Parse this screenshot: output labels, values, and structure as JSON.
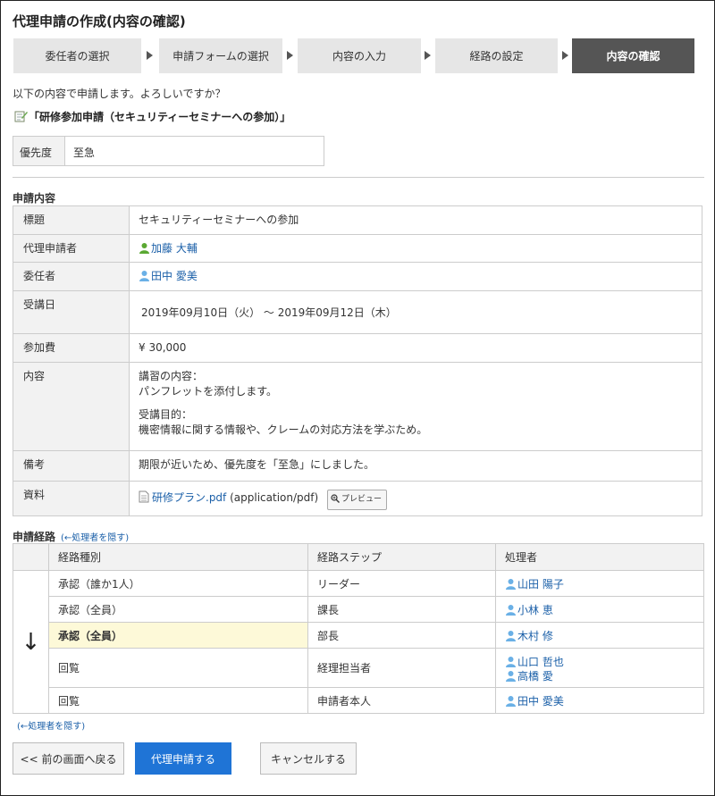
{
  "page": {
    "title": "代理申請の作成(内容の確認)",
    "confirm_message": "以下の内容で申請します。よろしいですか？",
    "form_name": "「研修参加申請（セキュリティーセミナーへの参加）」"
  },
  "steps": [
    {
      "label": "委任者の選択",
      "active": false
    },
    {
      "label": "申請フォームの選択",
      "active": false
    },
    {
      "label": "内容の入力",
      "active": false
    },
    {
      "label": "経路の設定",
      "active": false
    },
    {
      "label": "内容の確認",
      "active": true
    }
  ],
  "priority": {
    "label": "優先度",
    "value": "至急"
  },
  "detail": {
    "section_title": "申請内容",
    "rows": {
      "subject": {
        "label": "標題",
        "value": "セキュリティーセミナーへの参加"
      },
      "proxy": {
        "label": "代理申請者",
        "value": "加藤 大輔"
      },
      "delegator": {
        "label": "委任者",
        "value": "田中 愛美"
      },
      "date": {
        "label": "受講日",
        "value": "2019年09月10日（火） 〜 2019年09月12日（木）"
      },
      "fee": {
        "label": "参加費",
        "value": "¥ 30,000"
      },
      "content": {
        "label": "内容",
        "lines": [
          "講習の内容：",
          "パンフレットを添付します。",
          "",
          "受講目的：",
          "機密情報に関する情報や、クレームの対応方法を学ぶため。"
        ]
      },
      "note": {
        "label": "備考",
        "value": "期限が近いため、優先度を「至急」にしました。"
      },
      "file": {
        "label": "資料",
        "filename": "研修プラン.pdf",
        "mime": "(application/pdf)",
        "preview_label": "プレビュー"
      }
    }
  },
  "route": {
    "section_title": "申請経路",
    "hide_link": "(←処理者を隠す)",
    "headers": {
      "type": "経路種別",
      "step": "経路ステップ",
      "handler": "処理者"
    },
    "arrow": "↓",
    "rows": [
      {
        "type": "承認（誰か1人）",
        "step": "リーダー",
        "handlers": [
          "山田 陽子"
        ]
      },
      {
        "type": "承認（全員）",
        "step": "課長",
        "handlers": [
          "小林 恵"
        ]
      },
      {
        "type": "承認（全員）",
        "step": "部長",
        "handlers": [
          "木村 修"
        ]
      },
      {
        "type": "回覧",
        "step": "経理担当者",
        "handlers": [
          "山口 哲也",
          "高橋 愛"
        ]
      },
      {
        "type": "回覧",
        "step": "申請者本人",
        "handlers": [
          "田中 愛美"
        ]
      }
    ]
  },
  "buttons": {
    "back": "<< 前の画面へ戻る",
    "submit": "代理申請する",
    "cancel": "キャンセルする"
  },
  "colors": {
    "link": "#1a5fa8",
    "primary": "#1f74d6",
    "active_step": "#555555",
    "current_row": "#fdf9d8"
  }
}
